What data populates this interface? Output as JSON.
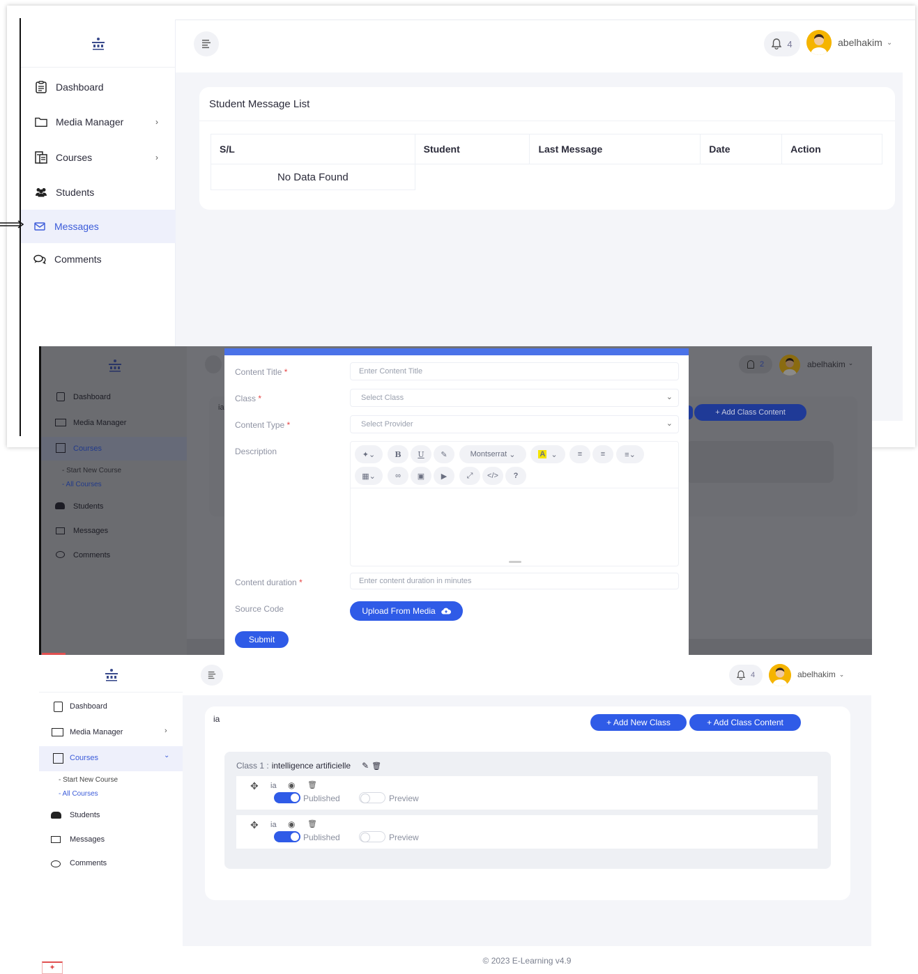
{
  "top": {
    "sidebar": {
      "items": [
        {
          "label": "Dashboard",
          "icon": "clipboard-icon"
        },
        {
          "label": "Media Manager",
          "icon": "folder-icon"
        },
        {
          "label": "Courses",
          "icon": "courses-icon"
        },
        {
          "label": "Students",
          "icon": "users-icon"
        },
        {
          "label": "Messages",
          "icon": "envelope-icon"
        },
        {
          "label": "Comments",
          "icon": "comments-icon"
        }
      ],
      "active": "Messages"
    },
    "header": {
      "notifications": "4",
      "username": "abelhakim"
    },
    "card": {
      "title": "Student Message List",
      "columns": [
        "S/L",
        "Student",
        "Last Message",
        "Date",
        "Action"
      ],
      "empty": "No Data Found"
    }
  },
  "middle": {
    "sidebar": {
      "items": [
        "Dashboard",
        "Media Manager",
        "Courses",
        "Students",
        "Messages",
        "Comments"
      ],
      "sub": [
        "- Start New Course",
        "- All Courses"
      ]
    },
    "header": {
      "notifications": "2",
      "username": "abelhakim"
    },
    "bg_title": "ia",
    "bg_add_content": "+ Add Class Content",
    "modal": {
      "content_title_label": "Content Title",
      "content_title_placeholder": "Enter Content Title",
      "class_label": "Class",
      "class_placeholder": "Select Class",
      "content_type_label": "Content Type",
      "content_type_placeholder": "Select Provider",
      "description_label": "Description",
      "font_name": "Montserrat",
      "duration_label": "Content duration",
      "duration_placeholder": "Enter content duration in minutes",
      "source_label": "Source Code",
      "upload_button": "Upload From Media",
      "submit_button": "Submit",
      "required_mark": "*"
    }
  },
  "bottom": {
    "sidebar": {
      "items": [
        "Dashboard",
        "Media Manager",
        "Courses",
        "Students",
        "Messages",
        "Comments"
      ],
      "sub": [
        "- Start New Course",
        "- All Courses"
      ]
    },
    "header": {
      "notifications": "4",
      "username": "abelhakim"
    },
    "card": {
      "title": "ia",
      "add_class": "+ Add New Class",
      "add_content": "+ Add Class Content",
      "class_prefix": "Class 1 :",
      "class_name": "intelligence artificielle",
      "contents": [
        {
          "name": "ia",
          "published_label": "Published",
          "preview_label": "Preview",
          "published": true,
          "preview": false
        },
        {
          "name": "ia",
          "published_label": "Published",
          "preview_label": "Preview",
          "published": true,
          "preview": false
        }
      ]
    },
    "footer": "© 2023 E-Learning v4.9"
  },
  "colors": {
    "accent": "#2f5be7",
    "sidebar_active_bg": "#eef0fb",
    "page_bg": "#f4f5f9",
    "required": "#e64545"
  }
}
